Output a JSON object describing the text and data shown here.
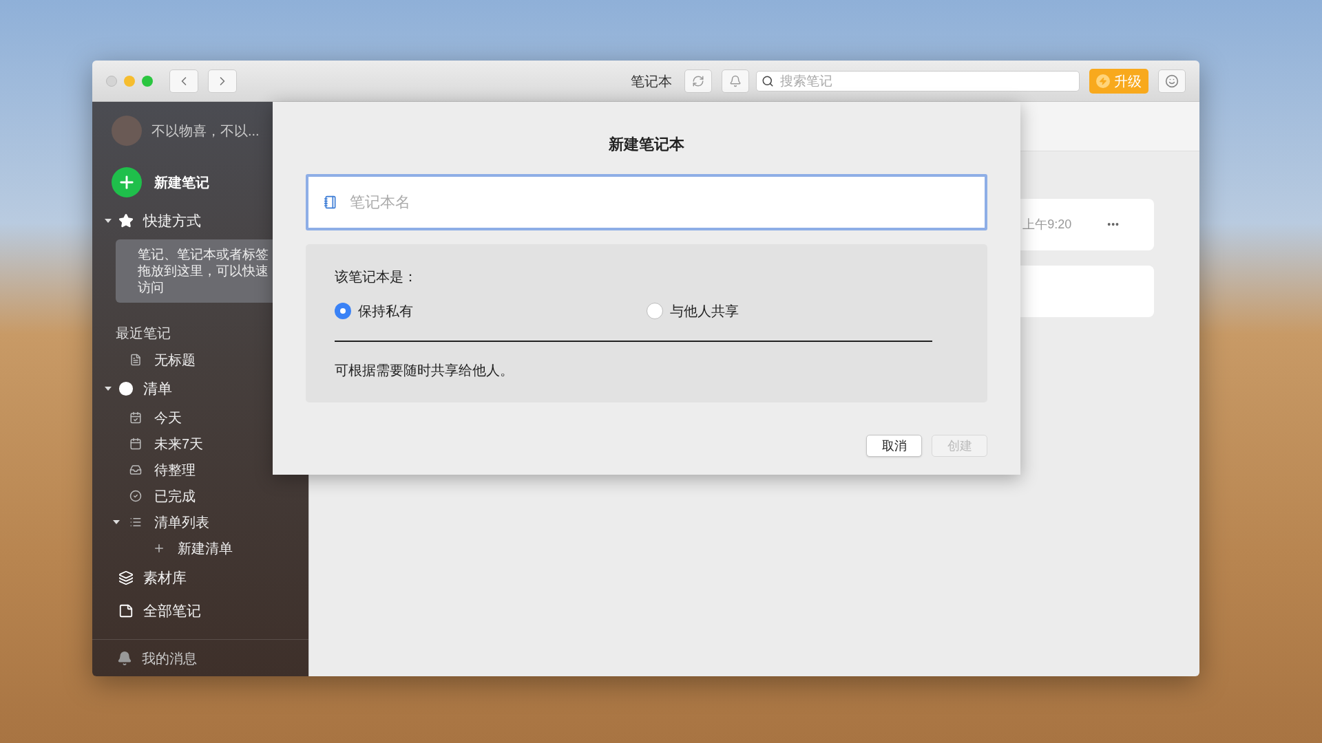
{
  "toolbar": {
    "title": "笔记本",
    "search": {
      "placeholder": "搜索笔记"
    },
    "upgrade": "升级"
  },
  "sidebar": {
    "account_name": "不以物喜，不以...",
    "new_note": "新建笔记",
    "items": [
      {
        "kind": "group",
        "label": "快捷方式",
        "expanded": true,
        "hint": "笔记、笔记本或者标签拖放到这里，可以快速访问"
      },
      {
        "kind": "heading",
        "label": "最近笔记",
        "children": [
          {
            "label": "无标题"
          }
        ]
      },
      {
        "kind": "group",
        "label": "清单",
        "expanded": true,
        "children": [
          {
            "label": "今天"
          },
          {
            "label": "未来7天"
          },
          {
            "label": "待整理"
          },
          {
            "label": "已完成"
          },
          {
            "label": "清单列表",
            "expanded": true,
            "children": [
              {
                "label": "新建清单"
              }
            ]
          }
        ]
      },
      {
        "kind": "top",
        "label": "素材库"
      },
      {
        "kind": "top",
        "label": "全部笔记"
      }
    ],
    "footer": "我的消息"
  },
  "notes": [
    {
      "time": "上午9:20",
      "menu": "•••"
    }
  ],
  "dialog": {
    "title": "新建笔记本",
    "name_field": {
      "placeholder": "笔记本名"
    },
    "question": "该笔记本是：",
    "options": [
      {
        "label": "保持私有",
        "selected": true
      },
      {
        "label": "与他人共享",
        "selected": false
      }
    ],
    "note": "可根据需要随时共享给他人。",
    "buttons": [
      {
        "label": "取消",
        "disabled": false
      },
      {
        "label": "创建",
        "disabled": true
      }
    ]
  }
}
